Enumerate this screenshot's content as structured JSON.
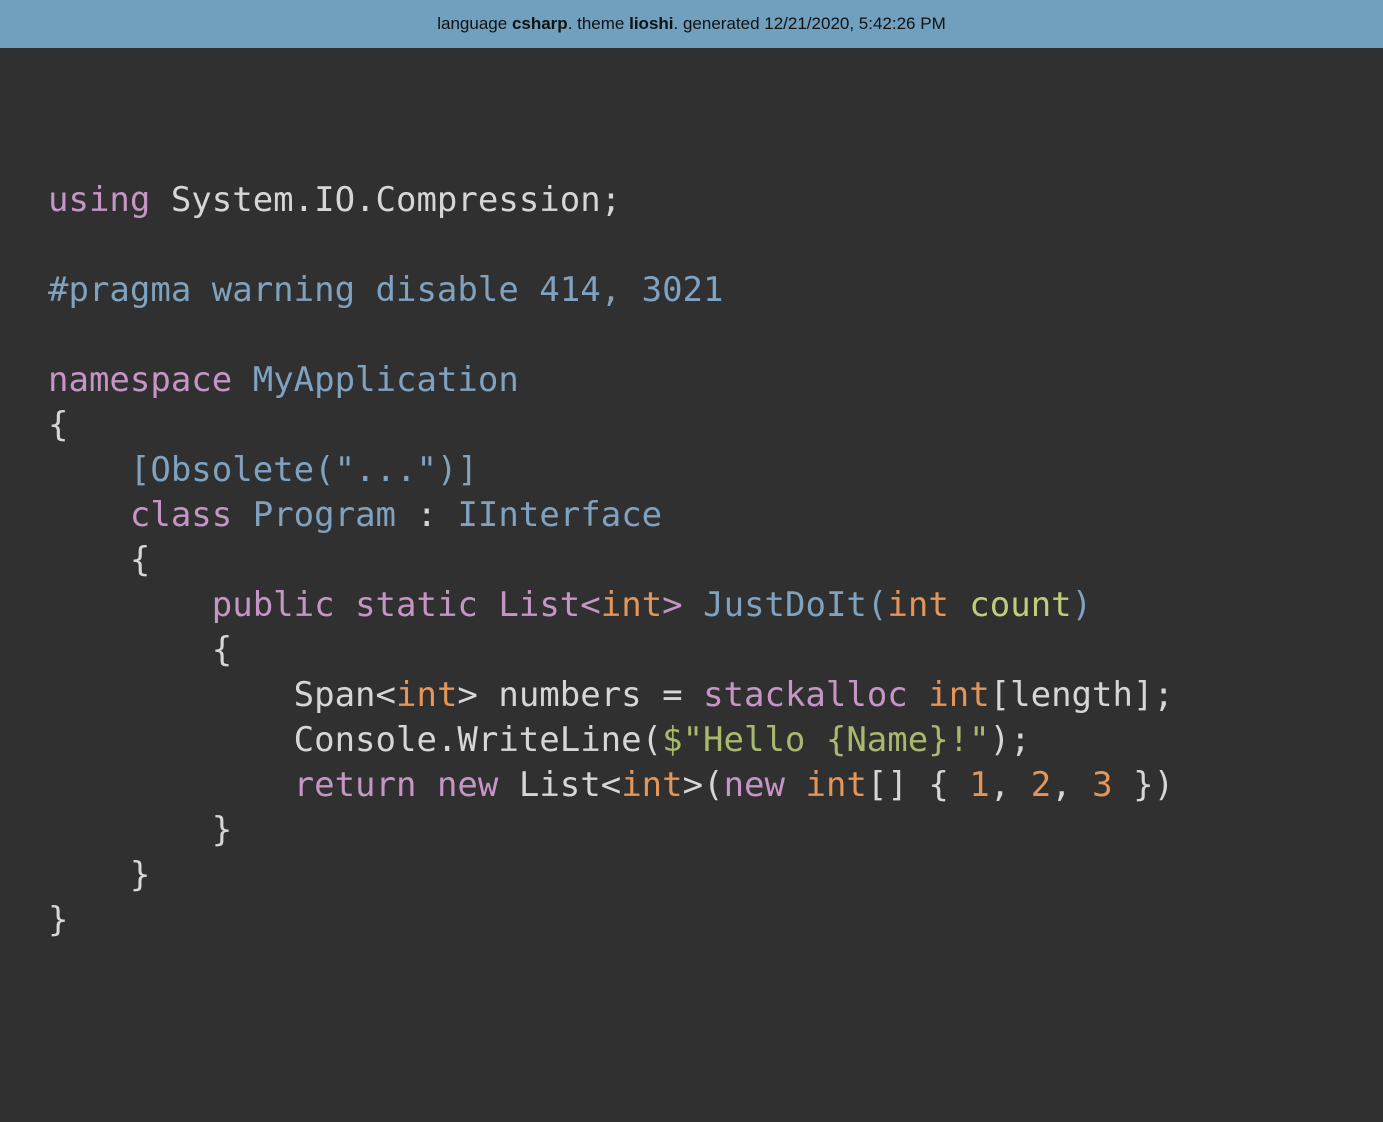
{
  "header": {
    "prefix": "language ",
    "language": "csharp",
    "mid1": ". theme ",
    "theme": "lioshi",
    "mid2": ". generated ",
    "generated": "12/21/2020, 5:42:26 PM"
  },
  "colors": {
    "background": "#303030",
    "header_bg": "#70a0bd",
    "keyword": "#c695c6",
    "type": "#7fa2c0",
    "number": "#e3955a",
    "string": "#a8b96c",
    "plain": "#d6d6d6"
  },
  "code": {
    "l1": {
      "t1": "using",
      "t2": " System.IO.Compression;"
    },
    "l3": {
      "t1": "#pragma warning disable 414, 3021"
    },
    "l5": {
      "t1": "namespace",
      "t2": " ",
      "t3": "MyApplication"
    },
    "l6": {
      "t1": "{"
    },
    "l7": {
      "t1": "    ",
      "t2": "[Obsolete(\"...\")]"
    },
    "l8": {
      "t1": "    ",
      "t2": "class",
      "t3": " ",
      "t4": "Program",
      "t5": " : ",
      "t6": "IInterface"
    },
    "l9": {
      "t1": "    {"
    },
    "l10": {
      "t1": "        ",
      "t2": "public",
      "t3": " ",
      "t4": "static",
      "t5": " ",
      "t6": "List<",
      "t7": "int",
      "t8": ">",
      "t9": " ",
      "t10": "JustDoIt(",
      "t11": "int",
      "t12": " ",
      "t13": "count",
      "t14": ")"
    },
    "l11": {
      "t1": "        {"
    },
    "l12": {
      "t1": "            Span<",
      "t2": "int",
      "t3": "> numbers = ",
      "t4": "stackalloc",
      "t5": " ",
      "t6": "int",
      "t7": "[length];"
    },
    "l13": {
      "t1": "            Console.WriteLine(",
      "t2": "$\"Hello {Name}!\"",
      "t3": ");"
    },
    "l14": {
      "t1": "            ",
      "t2": "return",
      "t3": " ",
      "t4": "new",
      "t5": " List<",
      "t6": "int",
      "t7": ">(",
      "t8": "new",
      "t9": " ",
      "t10": "int",
      "t11": "[] { ",
      "t12": "1",
      "t13": ", ",
      "t14": "2",
      "t15": ", ",
      "t16": "3",
      "t17": " })"
    },
    "l15": {
      "t1": "        }"
    },
    "l16": {
      "t1": "    }"
    },
    "l17": {
      "t1": "}"
    }
  }
}
